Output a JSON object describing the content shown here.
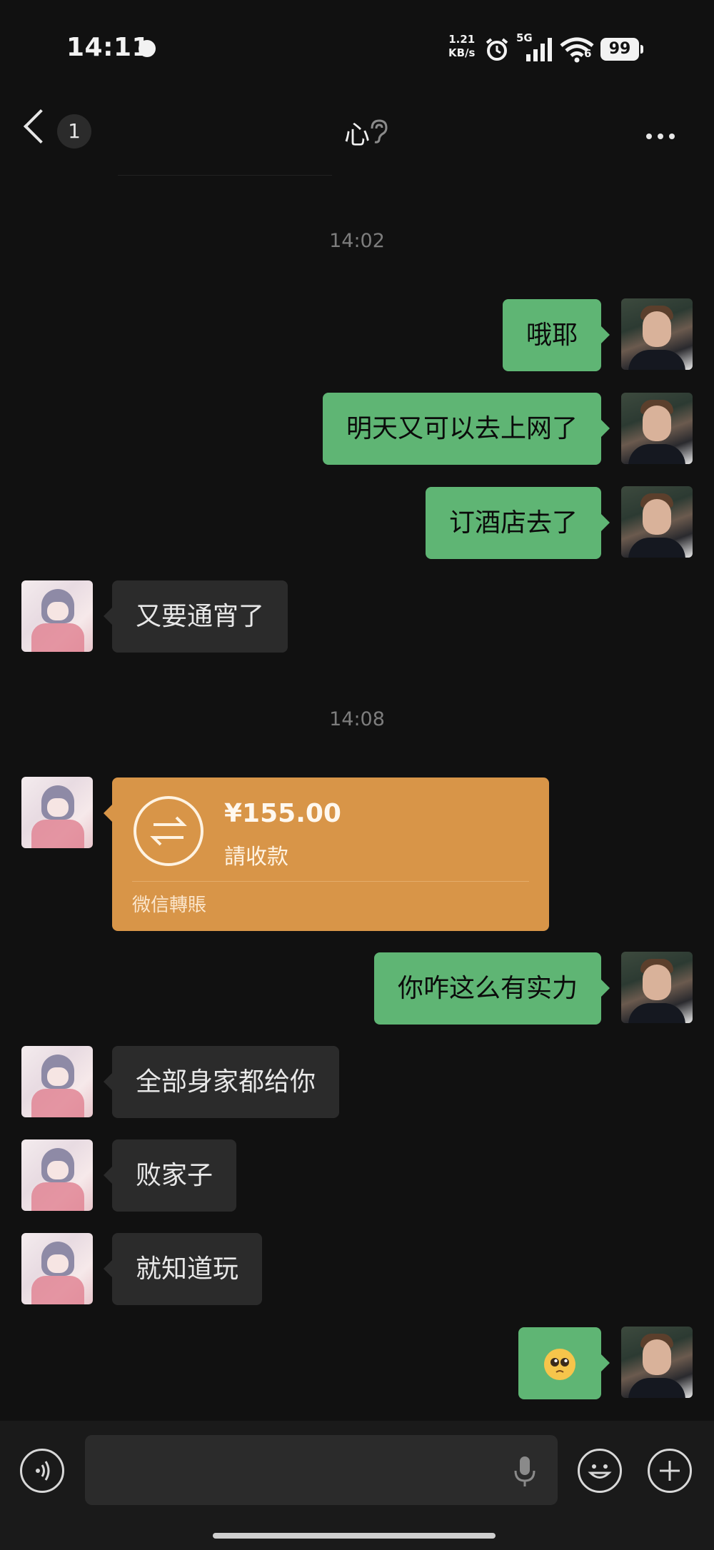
{
  "status_bar": {
    "time": "14:11",
    "net_speed_value": "1.21",
    "net_speed_unit": "KB/s",
    "network": "5G",
    "wifi_sub": "6",
    "battery": "99"
  },
  "header": {
    "unread_count": "1",
    "title": "心"
  },
  "timestamps": [
    "14:02",
    "14:08"
  ],
  "messages": [
    {
      "sender": "me",
      "text": "哦耶"
    },
    {
      "sender": "me",
      "text": "明天又可以去上网了"
    },
    {
      "sender": "me",
      "text": "订酒店去了"
    },
    {
      "sender": "her",
      "text": "又要通宵了"
    },
    {
      "sender": "me",
      "text": "你咋这么有实力"
    },
    {
      "sender": "her",
      "text": "全部身家都给你"
    },
    {
      "sender": "her",
      "text": "败家子"
    },
    {
      "sender": "her",
      "text": "就知道玩"
    },
    {
      "sender": "me",
      "text": "",
      "emoji": "pleading-face"
    }
  ],
  "transfer": {
    "amount": "¥155.00",
    "status": "請收款",
    "brand": "微信轉賬",
    "color": "#d89548"
  },
  "input": {
    "value": "",
    "placeholder": ""
  },
  "colors": {
    "background": "#111111",
    "my_bubble": "#5fb574",
    "her_bubble": "#2b2b2b"
  }
}
